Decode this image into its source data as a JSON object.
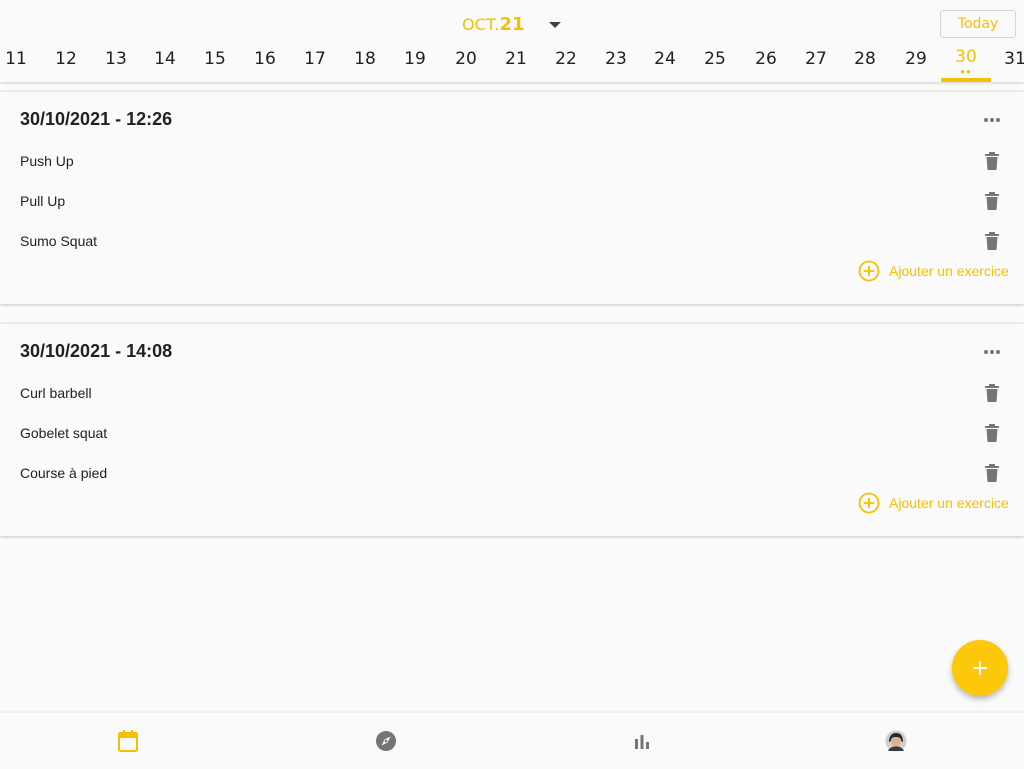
{
  "header": {
    "month_label": "OCT.",
    "month_day": "21",
    "today_label": "Today",
    "days": [
      "11",
      "12",
      "13",
      "14",
      "15",
      "16",
      "17",
      "18",
      "19",
      "20",
      "21",
      "22",
      "23",
      "24",
      "25",
      "26",
      "27",
      "28",
      "29",
      "30",
      "31"
    ],
    "selected_day": "30",
    "selected_day_dots": "●●"
  },
  "sessions": [
    {
      "title": "30/10/2021 - 12:26",
      "exercises": [
        "Push Up",
        "Pull Up",
        "Sumo Squat"
      ],
      "add_label": "Ajouter un exercice"
    },
    {
      "title": "30/10/2021 - 14:08",
      "exercises": [
        "Curl barbell",
        "Gobelet squat",
        "Course à pied"
      ],
      "add_label": "Ajouter un exercice"
    }
  ],
  "bottom_nav": {
    "items": [
      "calendar-icon",
      "compass-icon",
      "bar-chart-icon",
      "profile-avatar"
    ],
    "active": "calendar-icon"
  },
  "colors": {
    "accent": "#f5c000",
    "fab": "#fdc80a",
    "icon_grey": "#757575",
    "text": "#212121",
    "background": "#fafafa"
  }
}
